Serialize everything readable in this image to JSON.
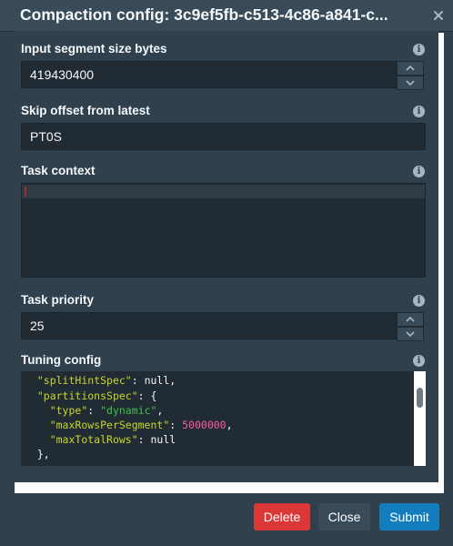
{
  "dialog": {
    "title": "Compaction config: 3c9ef5fb-c513-4c86-a841-c...",
    "close_icon": "close-icon"
  },
  "fields": {
    "input_segment_size": {
      "label": "Input segment size bytes",
      "value": "419430400"
    },
    "skip_offset": {
      "label": "Skip offset from latest",
      "value": "PT0S"
    },
    "task_context": {
      "label": "Task context",
      "value": ""
    },
    "task_priority": {
      "label": "Task priority",
      "value": "25"
    },
    "tuning_config": {
      "label": "Tuning config"
    }
  },
  "code": {
    "lines": [
      {
        "indent": "  ",
        "key": "\"splitHintSpec\"",
        "sep": ": ",
        "val": "null",
        "val_type": "p",
        "tail": ","
      },
      {
        "indent": "  ",
        "key": "\"partitionsSpec\"",
        "sep": ": ",
        "val": "{",
        "val_type": "p",
        "tail": ""
      },
      {
        "indent": "    ",
        "key": "\"type\"",
        "sep": ": ",
        "val": "\"dynamic\"",
        "val_type": "s",
        "tail": ","
      },
      {
        "indent": "    ",
        "key": "\"maxRowsPerSegment\"",
        "sep": ": ",
        "val": "5000000",
        "val_type": "n",
        "tail": ","
      },
      {
        "indent": "    ",
        "key": "\"maxTotalRows\"",
        "sep": ": ",
        "val": "null",
        "val_type": "p",
        "tail": ""
      },
      {
        "indent": "  ",
        "key": "",
        "sep": "",
        "val": "},",
        "val_type": "p",
        "tail": ""
      }
    ]
  },
  "icons": {
    "info": "info-icon",
    "up": "chevron-up-icon",
    "down": "chevron-down-icon"
  },
  "info_glyph": "i",
  "buttons": {
    "delete": "Delete",
    "close": "Close",
    "submit": "Submit"
  },
  "colors": {
    "danger": "#db3737",
    "primary": "#137cbd",
    "secondary": "#394b59"
  }
}
